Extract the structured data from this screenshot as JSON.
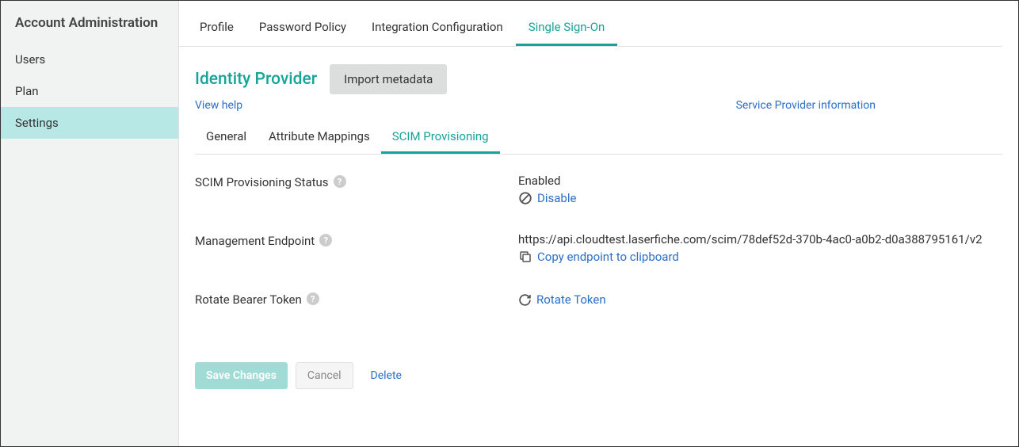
{
  "sidebar": {
    "title": "Account Administration",
    "items": [
      {
        "label": "Users"
      },
      {
        "label": "Plan"
      },
      {
        "label": "Settings"
      }
    ]
  },
  "topTabs": [
    {
      "label": "Profile"
    },
    {
      "label": "Password Policy"
    },
    {
      "label": "Integration Configuration"
    },
    {
      "label": "Single Sign-On"
    }
  ],
  "section": {
    "title": "Identity Provider",
    "importBtn": "Import metadata",
    "viewHelp": "View help",
    "spInfo": "Service Provider information"
  },
  "subTabs": [
    {
      "label": "General"
    },
    {
      "label": "Attribute Mappings"
    },
    {
      "label": "SCIM Provisioning"
    }
  ],
  "form": {
    "status": {
      "label": "SCIM Provisioning Status",
      "value": "Enabled",
      "action": "Disable"
    },
    "endpoint": {
      "label": "Management Endpoint",
      "value": "https://api.cloudtest.laserfiche.com/scim/78def52d-370b-4ac0-a0b2-d0a388795161/v2",
      "action": "Copy endpoint to clipboard"
    },
    "token": {
      "label": "Rotate Bearer Token",
      "action": "Rotate Token"
    }
  },
  "footer": {
    "save": "Save Changes",
    "cancel": "Cancel",
    "delete": "Delete"
  }
}
